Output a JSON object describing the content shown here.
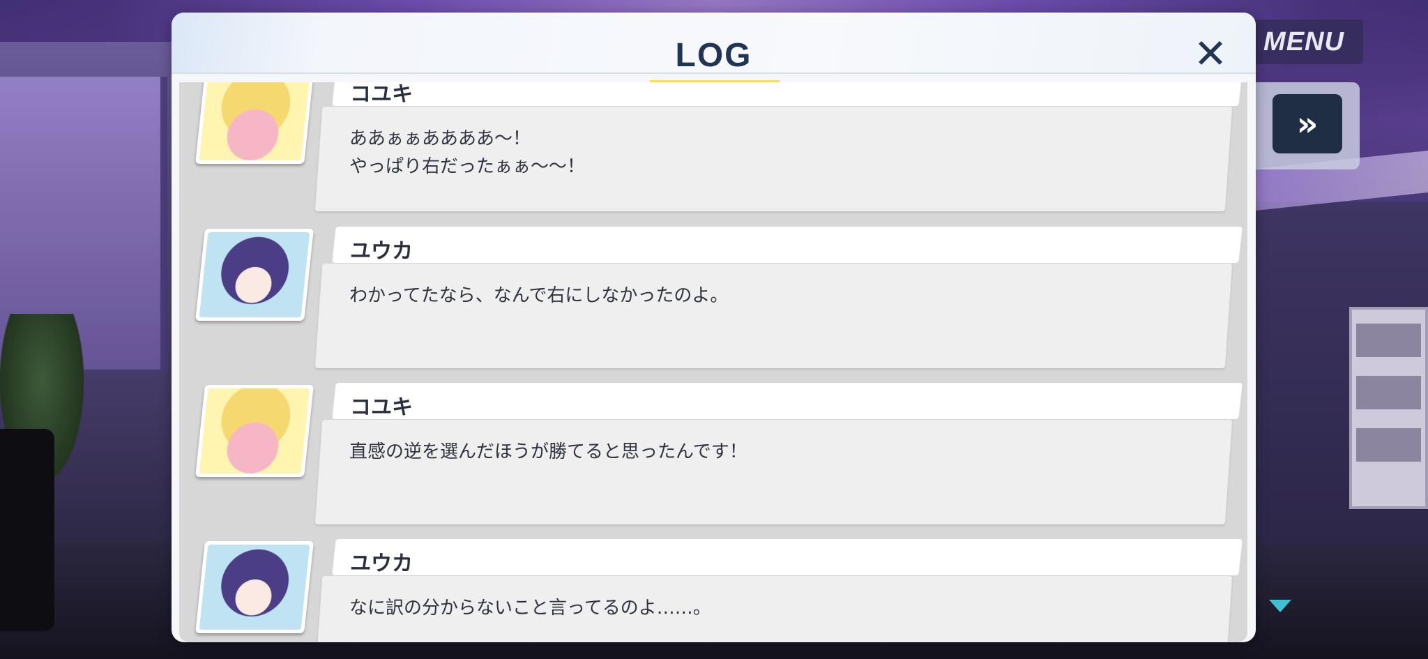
{
  "menu_label": "MENU",
  "log": {
    "title": "LOG",
    "close_symbol": "✕",
    "entries": [
      {
        "speaker": "コユキ",
        "lines": [
          "ああぁぁああああ～！",
          "やっぱり右だったぁぁ～～！"
        ],
        "character": "koyuki"
      },
      {
        "speaker": "ユウカ",
        "lines": [
          "わかってたなら、なんで右にしなかったのよ。"
        ],
        "character": "yuuka"
      },
      {
        "speaker": "コユキ",
        "lines": [
          "直感の逆を選んだほうが勝てると思ったんです！"
        ],
        "character": "koyuki"
      },
      {
        "speaker": "ユウカ",
        "lines": [
          "なに訳の分からないこと言ってるのよ……。"
        ],
        "character": "yuuka"
      }
    ]
  },
  "fast_forward_symbol": "»",
  "colors": {
    "title": "#203553",
    "underline": "#f5e23b",
    "scroll_arrow": "#3fc0d4"
  },
  "icons": {
    "close": "close-icon",
    "fast_forward": "fast-forward-icon",
    "scroll_down": "chevron-down-icon"
  }
}
